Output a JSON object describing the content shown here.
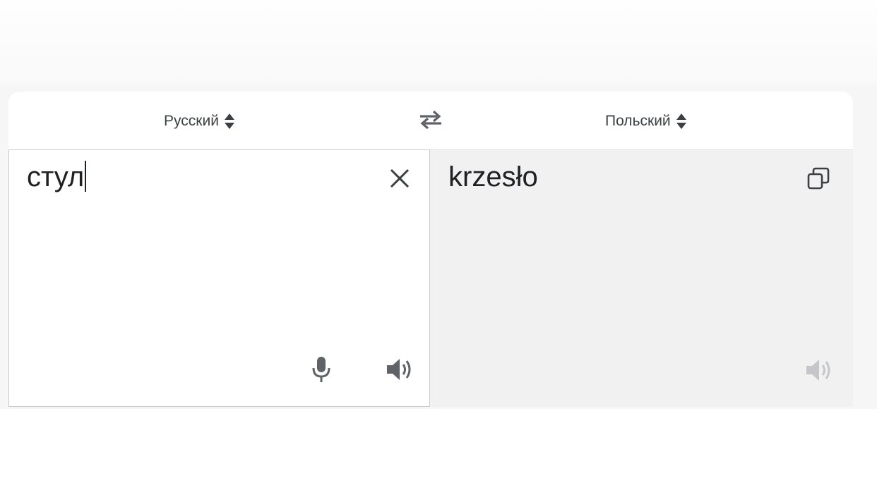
{
  "language_bar": {
    "source_language": "Русский",
    "target_language": "Польский"
  },
  "source": {
    "text": "стул"
  },
  "target": {
    "text": "krzesło"
  },
  "icons": {
    "swap": "swap-arrows-icon",
    "clear": "close-icon",
    "microphone": "microphone-icon",
    "speaker": "speaker-icon",
    "copy": "copy-icon",
    "language_dropdown": "updown-arrows-icon"
  },
  "colors": {
    "text": "#202124",
    "icon": "#5f6368",
    "disabled_icon": "#c4c6c9",
    "target_background": "#f1f1f2"
  }
}
